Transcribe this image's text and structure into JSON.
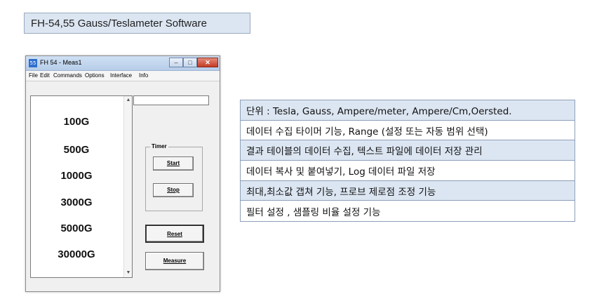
{
  "header": {
    "title": "FH-54,55 Gauss/Teslameter Software"
  },
  "window": {
    "title": "FH 54 - Meas1",
    "menu": [
      "File",
      "Edit",
      "Commands",
      "Options",
      "Interface",
      "Info"
    ],
    "ranges": [
      "100G",
      "500G",
      "1000G",
      "3000G",
      "5000G",
      "30000G"
    ],
    "readout_value": "",
    "timer": {
      "group_label": "Timer",
      "start_label": "Start",
      "stop_label": "Stop"
    },
    "reset_label": "Reset",
    "measure_label": "Measure"
  },
  "features": [
    "단위 : Tesla, Gauss, Ampere/meter, Ampere/Cm,Oersted.",
    "데이터 수집 타이머 기능, Range (설정 또는 자동 범위 선택)",
    "결과 테이블의 데이터 수집, 텍스트 파일에 데이터 저장 관리",
    "데이터 복사 및 붙여넣기, Log 데이터 파일 저장",
    "최대,최소값 갭쳐 기능, 프로브 제로점 조정 기능",
    "필터 설정 , 샘플링 비율 설정 기능"
  ],
  "colors": {
    "shaded_row": "#dce6f2",
    "title_bg": "#dce6f2",
    "border": "#8da0b8"
  }
}
